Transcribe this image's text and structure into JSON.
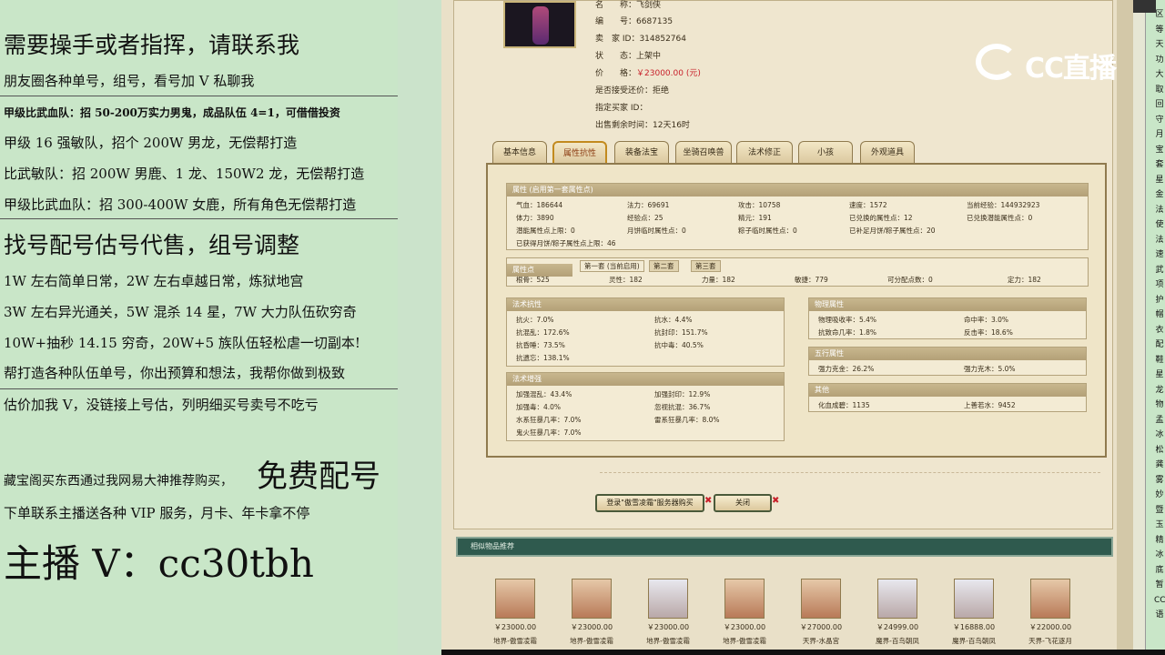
{
  "left_panel": {
    "lines": [
      "需要操手或者指挥，请联系我",
      "朋友圈各种单号，组号，看号加 V 私聊我",
      "甲级比武血队：招 50-200万实力男鬼，成品队伍 4=1，可借借投资",
      "甲级 16 强敏队，招个 200W 男龙，无偿帮打造",
      "比武敏队：招 200W 男鹿、1 龙、150W2 龙，无偿帮打造",
      "甲级比武血队：招 300-400W 女鹿，所有角色无偿帮打造",
      "找号配号估号代售，组号调整",
      "1W 左右简单日常，2W 左右卓越日常，炼狱地宫",
      "3W 左右异光通关，5W 混杀 14 星，7W 大力队伍砍穷奇",
      "10W+抽秒 14.15 穷奇，20W+5 族队伍轻松虐一切副本!",
      "帮打造各种队伍单号，你出预算和想法，我帮你做到极致",
      "估价加我 V，没链接上号估，列明细买号卖号不吃亏",
      "藏宝阁买东西通过我网易大神推荐购买，",
      "免费配号",
      "下单联系主播送各种 VIP 服务，月卡、年卡拿不停",
      "主播 V：cc30tbh"
    ]
  },
  "listing": {
    "rows": [
      {
        "label": "名　　称：",
        "value": "飞剑侠"
      },
      {
        "label": "编　　号：",
        "value": "6687135"
      },
      {
        "label": "卖　家 ID：",
        "value": "314852764"
      },
      {
        "label": "状　　态：",
        "value": "上架中"
      },
      {
        "label": "价　　格：",
        "value": "￥23000.00 (元)"
      },
      {
        "label": "是否接受还价：",
        "value": "拒绝"
      },
      {
        "label": "指定买家 ID：",
        "value": ""
      },
      {
        "label": "出售剩余时间：",
        "value": "12天16时"
      }
    ]
  },
  "tabs": [
    "基本信息",
    "属性抗性",
    "装备法宝",
    "坐骑召唤兽",
    "法术修正",
    "小孩",
    "外观道具"
  ],
  "attributes": {
    "header": "属性 (启用第一套属性点)",
    "cells": [
      "气血：186644",
      "法力：69691",
      "攻击：10758",
      "速度：1572",
      "当前经验：144932923",
      "体力：3890",
      "经验点：25",
      "精元：191",
      "已兑换的属性点：12",
      "已兑换潜能属性点：0",
      "潜能属性点上限：0",
      "月饼临时属性点：0",
      "粽子临时属性点：0",
      "已补足月饼/粽子属性点：20",
      "已获得月饼/粽子属性点上限：46"
    ]
  },
  "points": {
    "header": "属性点",
    "subtabs": [
      "第一套 (当前启用)",
      "第二套",
      "第三套"
    ],
    "cells": [
      "根骨：525",
      "灵性：182",
      "力量：182",
      "敏捷：779",
      "可分配点数：0",
      "定力：182"
    ]
  },
  "resist": {
    "header": "法术抗性",
    "cells": [
      "抗火：7.0%",
      "抗水：4.4%",
      "抗混乱：172.6%",
      "抗封印：151.7%",
      "抗昏睡：73.5%",
      "抗中毒：40.5%",
      "抗遗忘：138.1%"
    ]
  },
  "enhance": {
    "header": "法术增强",
    "cells": [
      "加强混乱：43.4%",
      "加强封印：12.9%",
      "加强毒：4.0%",
      "忽视抗混：36.7%",
      "水系狂暴几率：7.0%",
      "雷系狂暴几率：8.0%",
      "鬼火狂暴几率：7.0%"
    ]
  },
  "physical": {
    "header": "物理属性",
    "cells": [
      "物理吸收率：5.4%",
      "命中率：3.0%",
      "抗致命几率：1.8%",
      "反击率：18.6%"
    ]
  },
  "fiveel": {
    "header": "五行属性",
    "cells": [
      "强力克金：26.2%",
      "强力克木：5.0%"
    ]
  },
  "other": {
    "header": "其他",
    "cells": [
      "化血成碧：1135",
      "上善若水：9452"
    ]
  },
  "buttons": {
    "buy": "登录\"傲雪凌霜\"服务器购买",
    "close": "关闭"
  },
  "similar": {
    "title": "相似物品推荐",
    "items": [
      {
        "price": "￥23000.00",
        "name": "地界-傲雪凌霜"
      },
      {
        "price": "￥23000.00",
        "name": "地界-傲雪凌霜"
      },
      {
        "price": "￥23000.00",
        "name": "地界-傲雪凌霜"
      },
      {
        "price": "￥23000.00",
        "name": "地界-傲雪凌霜"
      },
      {
        "price": "￥27000.00",
        "name": "天界-水晶宫"
      },
      {
        "price": "￥24999.00",
        "name": "魔界-百鸟朝凤"
      },
      {
        "price": "￥16888.00",
        "name": "魔界-百鸟朝凤"
      },
      {
        "price": "￥22000.00",
        "name": "天界-飞花逐月"
      }
    ]
  },
  "watermark": "CC直播",
  "right_chars": [
    "区",
    "等",
    "天",
    "功",
    "大",
    "取",
    "回",
    "守",
    "月",
    "宝",
    "套",
    "星",
    "金",
    "法",
    "使",
    "法",
    "速",
    "武",
    "项",
    "护",
    "帽",
    "衣",
    "配",
    "鞋",
    "星",
    "龙",
    "物",
    "孟",
    "冰",
    "松",
    "龚",
    "雾",
    "妙",
    "暨",
    "玉",
    "精",
    "冰",
    "底",
    "暂",
    "CC",
    "语"
  ]
}
